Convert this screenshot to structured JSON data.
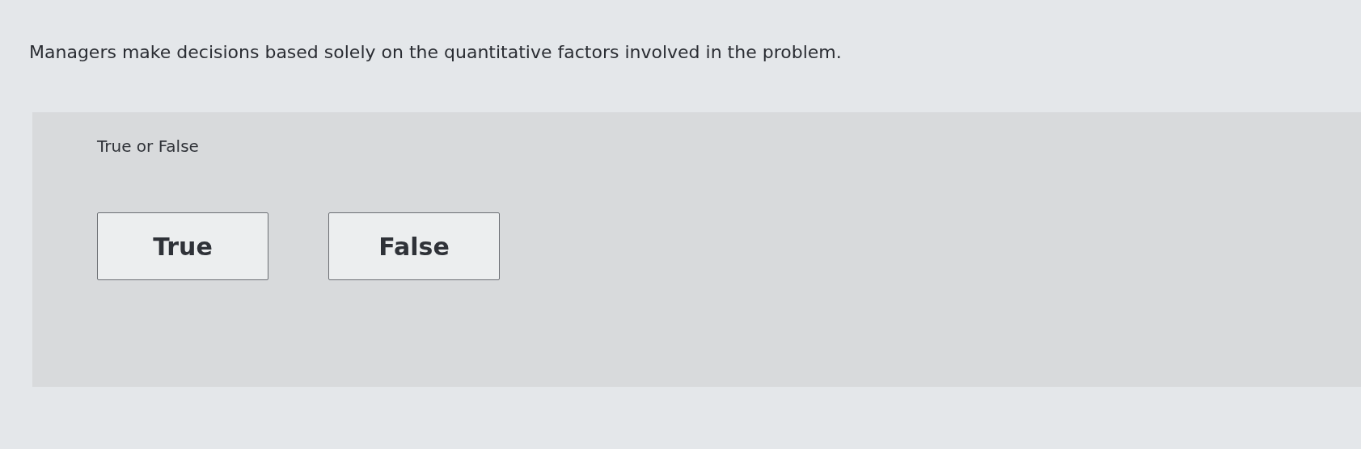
{
  "question": "Managers make decisions based solely on the quantitative factors involved in the problem.",
  "prompt": "True or False",
  "options": [
    {
      "label": "True",
      "selected": false
    },
    {
      "label": "False",
      "selected": false
    }
  ]
}
